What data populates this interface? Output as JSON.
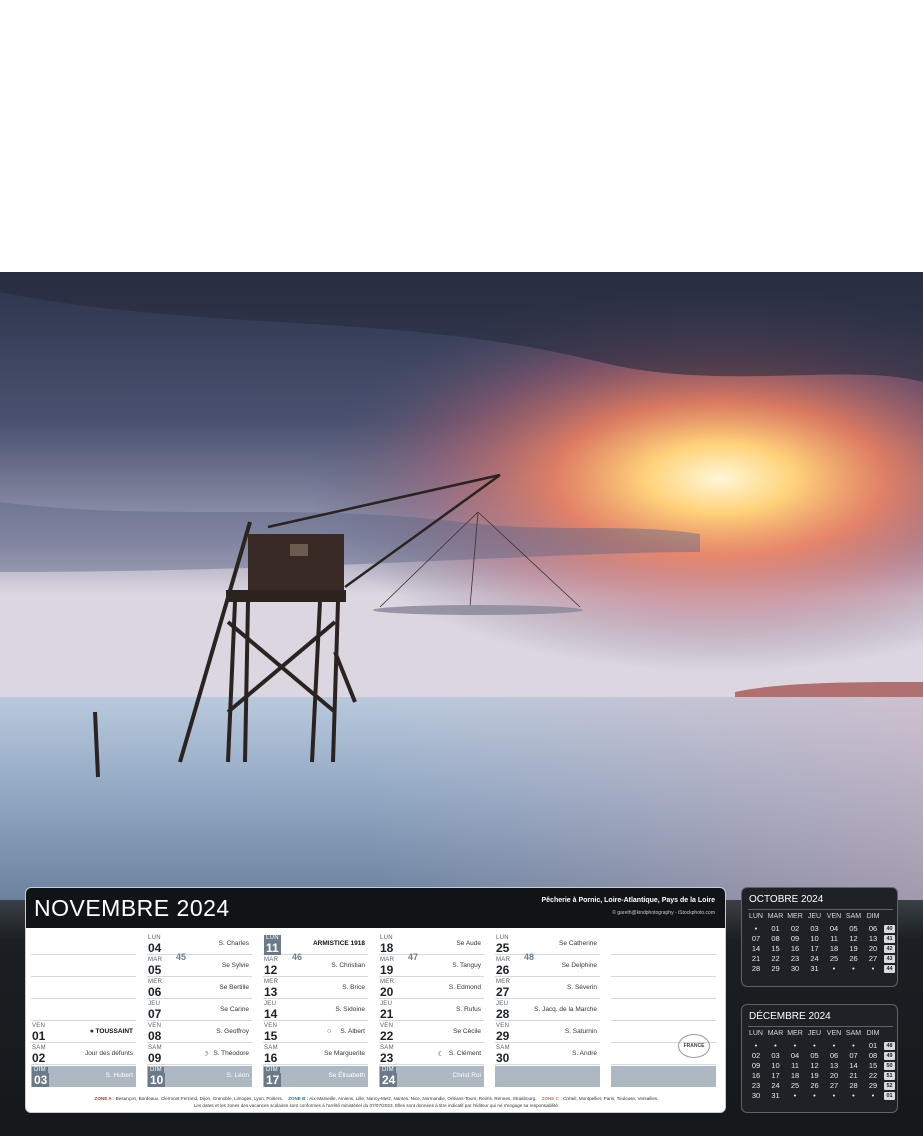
{
  "month_title": "NOVEMBRE 2024",
  "photo_caption": "Pêcherie à Pornic, Loire-Atlantique, Pays de la Loire",
  "photo_credit": "© gareth@kindphotography - iStockphoto.com",
  "colors": {
    "header": "#111417",
    "sunday": "#aeb8c2",
    "day_badge": "#6b7a88",
    "week_number": "#6e7e8c"
  },
  "week_numbers": [
    "45",
    "46",
    "47",
    "48"
  ],
  "columns": [
    {
      "days": [
        {
          "name": "",
          "num": "",
          "saint": ""
        },
        {
          "name": "",
          "num": "",
          "saint": ""
        },
        {
          "name": "",
          "num": "",
          "saint": ""
        },
        {
          "name": "",
          "num": "",
          "saint": ""
        },
        {
          "name": "VEN",
          "num": "01",
          "saint": "TOUSSAINT",
          "holiday": true,
          "moon": "new-moon"
        },
        {
          "name": "SAM",
          "num": "02",
          "saint": "Jour des défunts"
        },
        {
          "name": "DIM",
          "num": "03",
          "saint": "S. Hubert",
          "sunday": true
        }
      ]
    },
    {
      "days": [
        {
          "name": "LUN",
          "num": "04",
          "saint": "S. Charles"
        },
        {
          "name": "MAR",
          "num": "05",
          "saint": "Se Sylvie"
        },
        {
          "name": "MER",
          "num": "06",
          "saint": "Se Bertille"
        },
        {
          "name": "JEU",
          "num": "07",
          "saint": "Se Carine"
        },
        {
          "name": "VEN",
          "num": "08",
          "saint": "S. Geoffroy"
        },
        {
          "name": "SAM",
          "num": "09",
          "saint": "S. Théodore",
          "moon": "first-quarter"
        },
        {
          "name": "DIM",
          "num": "10",
          "saint": "S. Léon",
          "sunday": true
        }
      ]
    },
    {
      "days": [
        {
          "name": "LUN",
          "num": "11",
          "saint": "ARMISTICE 1918",
          "holiday": true
        },
        {
          "name": "MAR",
          "num": "12",
          "saint": "S. Christian"
        },
        {
          "name": "MER",
          "num": "13",
          "saint": "S. Brice"
        },
        {
          "name": "JEU",
          "num": "14",
          "saint": "S. Sidoine"
        },
        {
          "name": "VEN",
          "num": "15",
          "saint": "S. Albert",
          "moon": "full-moon"
        },
        {
          "name": "SAM",
          "num": "16",
          "saint": "Se Marguerite"
        },
        {
          "name": "DIM",
          "num": "17",
          "saint": "Se Élisabeth",
          "sunday": true
        }
      ]
    },
    {
      "days": [
        {
          "name": "LUN",
          "num": "18",
          "saint": "Se Aude"
        },
        {
          "name": "MAR",
          "num": "19",
          "saint": "S. Tanguy"
        },
        {
          "name": "MER",
          "num": "20",
          "saint": "S. Edmond"
        },
        {
          "name": "JEU",
          "num": "21",
          "saint": "S. Rufus"
        },
        {
          "name": "VEN",
          "num": "22",
          "saint": "Se Cécile"
        },
        {
          "name": "SAM",
          "num": "23",
          "saint": "S. Clément",
          "moon": "last-quarter"
        },
        {
          "name": "DIM",
          "num": "24",
          "saint": "Christ Roi",
          "sunday": true
        }
      ]
    },
    {
      "days": [
        {
          "name": "LUN",
          "num": "25",
          "saint": "Se Catherine"
        },
        {
          "name": "MAR",
          "num": "26",
          "saint": "Se Delphine"
        },
        {
          "name": "MER",
          "num": "27",
          "saint": "S. Séverin"
        },
        {
          "name": "JEU",
          "num": "28",
          "saint": "S. Jacq. de la Marche"
        },
        {
          "name": "VEN",
          "num": "29",
          "saint": "S. Saturnin"
        },
        {
          "name": "SAM",
          "num": "30",
          "saint": "S. André"
        },
        {
          "name": "",
          "num": "",
          "saint": "",
          "sunday": true
        }
      ]
    },
    {
      "days": [
        {
          "name": "",
          "num": "",
          "saint": ""
        },
        {
          "name": "",
          "num": "",
          "saint": ""
        },
        {
          "name": "",
          "num": "",
          "saint": ""
        },
        {
          "name": "",
          "num": "",
          "saint": ""
        },
        {
          "name": "",
          "num": "",
          "saint": ""
        },
        {
          "name": "",
          "num": "",
          "saint": ""
        },
        {
          "name": "",
          "num": "",
          "saint": "",
          "sunday": true
        }
      ]
    }
  ],
  "badge_text": "FRANCE",
  "zones": {
    "a_label": "ZONE A :",
    "a_text": "Besançon, Bordeaux, Clermont-Ferrand, Dijon, Grenoble, Limoges, Lyon, Poitiers.",
    "b_label": "ZONE B :",
    "b_text": "Aix-Marseille, Amiens, Lille, Nancy-Metz, Nantes, Nice, Normandie, Orléans-Tours, Reims, Rennes, Strasbourg.",
    "c_label": "ZONE C :",
    "c_text": "Créteil, Montpellier, Paris, Toulouse, Versailles.",
    "note": "Les dates et les zones des vacances scolaires sont conformes à l'arrêté ministériel du 07/07/2023. Elles sont données à titre indicatif par l'éditeur qui ne s'engage sa responsabilité."
  },
  "mini_calendars": [
    {
      "title": "OCTOBRE 2024",
      "headers": [
        "LUN",
        "MAR",
        "MER",
        "JEU",
        "VEN",
        "SAM",
        "DIM"
      ],
      "rows": [
        [
          "•",
          "01",
          "02",
          "03",
          "04",
          "05",
          "06"
        ],
        [
          "07",
          "08",
          "09",
          "10",
          "11",
          "12",
          "13"
        ],
        [
          "14",
          "15",
          "16",
          "17",
          "18",
          "19",
          "20"
        ],
        [
          "21",
          "22",
          "23",
          "24",
          "25",
          "26",
          "27"
        ],
        [
          "28",
          "29",
          "30",
          "31",
          "•",
          "•",
          "•"
        ]
      ],
      "weeks": [
        "40",
        "41",
        "42",
        "43",
        "44"
      ]
    },
    {
      "title": "DÉCEMBRE 2024",
      "headers": [
        "LUN",
        "MAR",
        "MER",
        "JEU",
        "VEN",
        "SAM",
        "DIM"
      ],
      "rows": [
        [
          "•",
          "•",
          "•",
          "•",
          "•",
          "•",
          "01"
        ],
        [
          "02",
          "03",
          "04",
          "05",
          "06",
          "07",
          "08"
        ],
        [
          "09",
          "10",
          "11",
          "12",
          "13",
          "14",
          "15"
        ],
        [
          "16",
          "17",
          "18",
          "19",
          "20",
          "21",
          "22"
        ],
        [
          "23",
          "24",
          "25",
          "26",
          "27",
          "28",
          "29"
        ],
        [
          "30",
          "31",
          "•",
          "•",
          "•",
          "•",
          "•"
        ]
      ],
      "weeks": [
        "48",
        "49",
        "50",
        "51",
        "52",
        "01"
      ]
    }
  ]
}
